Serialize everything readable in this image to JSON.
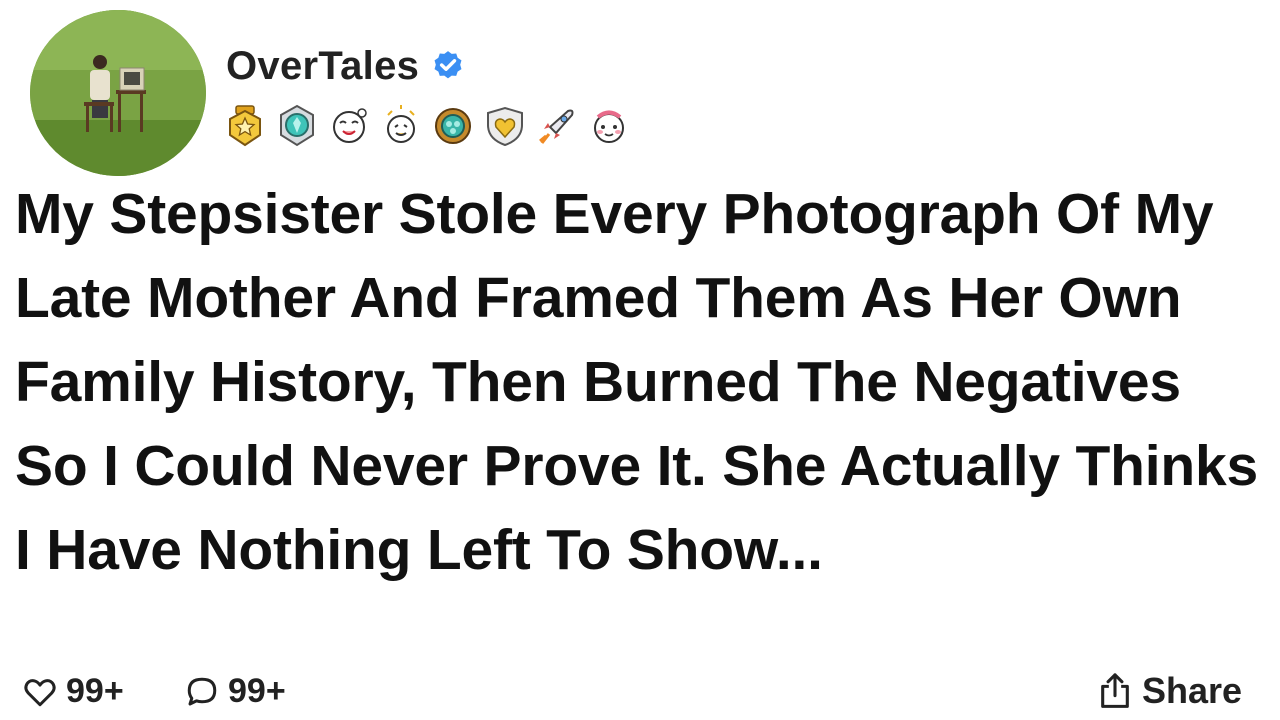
{
  "profile": {
    "username": "OverTales",
    "verified": true,
    "verified_color": "#3b8ff3",
    "badges": [
      "star-badge",
      "teal-gem-badge",
      "face-badge",
      "cheer-badge",
      "wreath-gem-badge",
      "heart-shield-badge",
      "rocket-badge",
      "blush-face-badge"
    ]
  },
  "post": {
    "title": "My Stepsister Stole Every Photograph Of My Late Mother And Framed Them As Her Own Family History, Then Burned The Negatives So I Could Never Prove It. She Actually Thinks I Have Nothing Left To Show..."
  },
  "footer": {
    "likes": "99+",
    "comments": "99+",
    "share_label": "Share"
  }
}
